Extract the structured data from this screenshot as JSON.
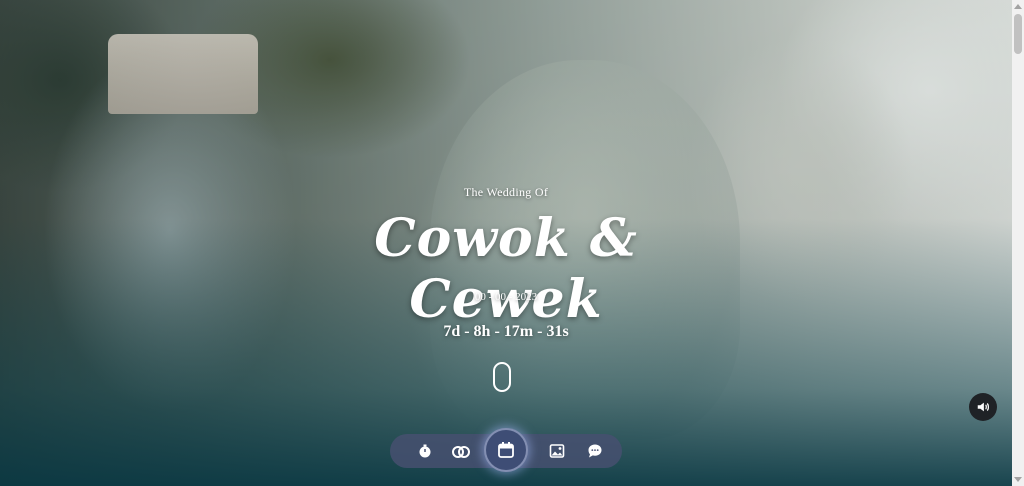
{
  "hero": {
    "subtitle": "The Wedding Of",
    "names": "Cowok & Cewek",
    "date": "00 - 00 - 2023",
    "countdown": "7d - 8h - 17m - 31s"
  },
  "controls": {
    "scroll_indicator": "mouse-scroll-icon",
    "sound": "speaker-icon"
  },
  "nav": {
    "items": [
      {
        "icon": "stopwatch-icon",
        "active": false
      },
      {
        "icon": "rings-icon",
        "active": false
      },
      {
        "icon": "calendar-icon",
        "active": true
      },
      {
        "icon": "gallery-icon",
        "active": false
      },
      {
        "icon": "chat-icon",
        "active": false
      }
    ]
  },
  "colors": {
    "nav_bg": "#465070",
    "nav_active": "#3e4d75",
    "overlay_bottom": "#083742",
    "text": "#ffffff"
  }
}
